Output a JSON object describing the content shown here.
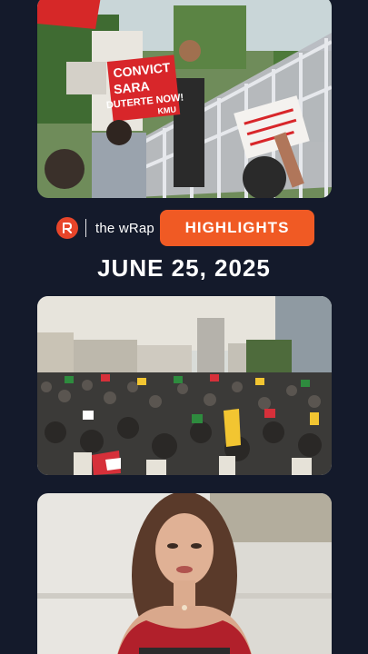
{
  "brand": {
    "name": "the wRap",
    "logo_icon": "rappler-icon"
  },
  "button": {
    "label": "HIGHLIGHTS"
  },
  "date": "JUNE 25, 2025",
  "story1": {
    "sign_line1": "CONVICT",
    "sign_line2": "SARA",
    "sign_line3": "DUTERTE NOW!",
    "sign_line4": "KMU"
  },
  "colors": {
    "background": "#141a2b",
    "accent": "#f05a24",
    "logo": "#e8452a"
  }
}
